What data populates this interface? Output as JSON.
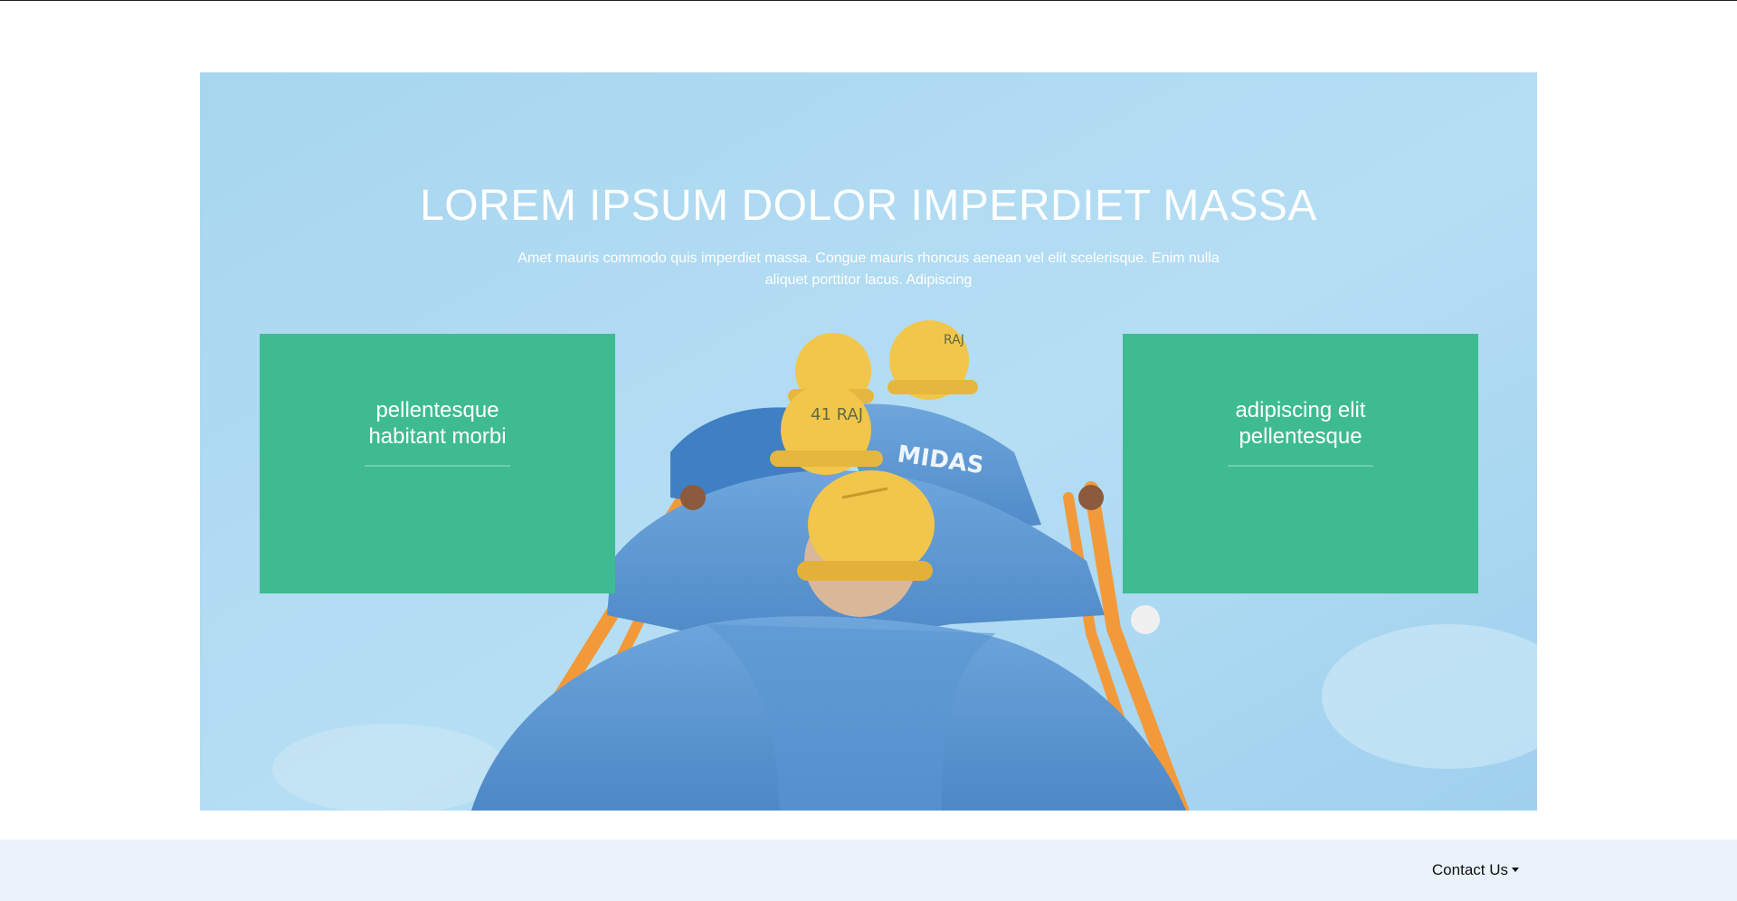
{
  "hero": {
    "title": "LOREM IPSUM DOLOR IMPERDIET MASSA",
    "subtitle": "Amet mauris commodo quis imperdiet massa. Congue mauris rhoncus aenean vel elit scelerisque. Enim nulla aliquet porttitor lacus. Adipiscing",
    "photo_logo_text": "MIDAS",
    "helmet_labels": [
      "RAJ",
      "41 RAJ"
    ]
  },
  "cards": [
    {
      "title": "pellentesque\nhabitant morbi"
    },
    {
      "title": "adipiscing elit\npellentesque"
    }
  ],
  "footer": {
    "contact_label": "Contact Us",
    "contact_icon": "caret-down-icon"
  },
  "colors": {
    "card_bg": "#3fbb91",
    "sky": "#b7def3",
    "footer_bg": "#eaf3fc",
    "rail_orange": "#f39a3b",
    "shirt_blue": "#4f8fd0",
    "helmet_yellow": "#f2c64b"
  }
}
